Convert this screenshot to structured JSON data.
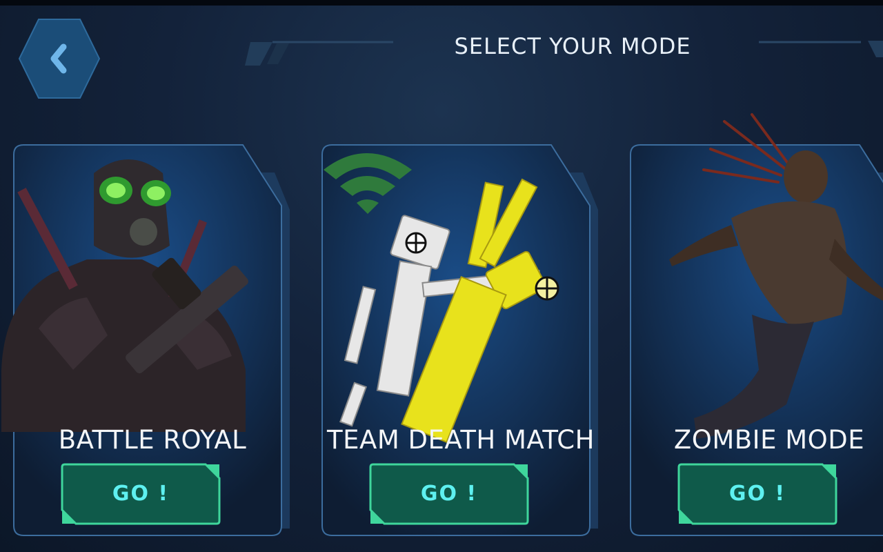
{
  "header": {
    "title": "SELECT YOUR MODE",
    "back_icon": "chevron-left-icon"
  },
  "modes": [
    {
      "label": "BATTLE ROYAL",
      "button": "GO !"
    },
    {
      "label": "TEAM DEATH MATCH",
      "button": "GO !",
      "status_icon": "wifi-icon"
    },
    {
      "label": "ZOMBIE MODE",
      "button": "GO !"
    }
  ],
  "colors": {
    "accent": "#3fd69c",
    "button_fill": "#0f5a4a",
    "button_text": "#5ef0f0",
    "card_border": "#3c6d9e",
    "back_button": "#1b4d78"
  }
}
